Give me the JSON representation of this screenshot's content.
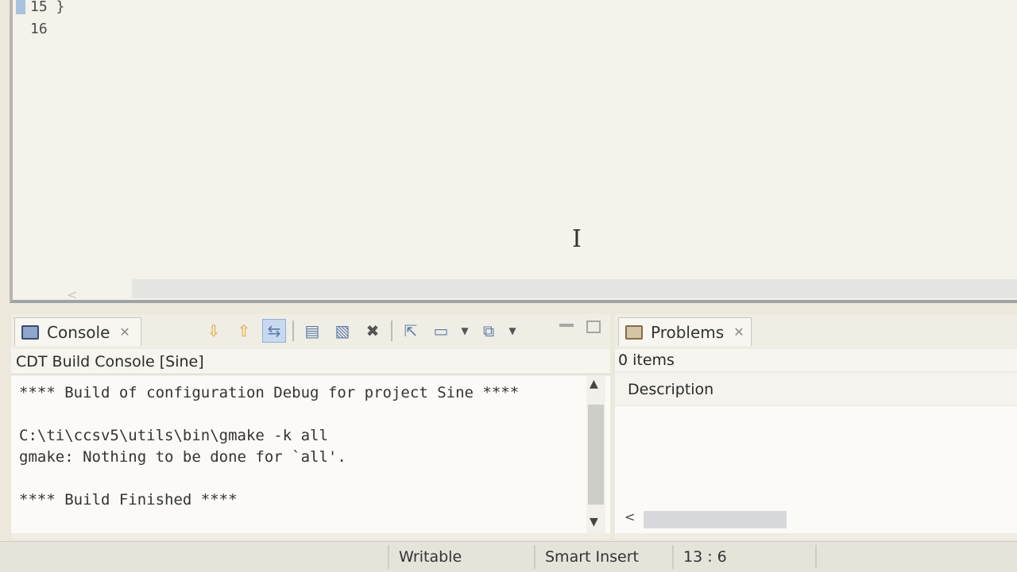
{
  "editor": {
    "lines": [
      {
        "number": "15",
        "text": "}"
      },
      {
        "number": "16",
        "text": ""
      }
    ]
  },
  "console": {
    "tab_label": "Console",
    "subtitle": "CDT Build Console [Sine]",
    "output_lines": [
      "**** Build of configuration Debug for project Sine ****",
      "",
      "C:\\ti\\ccsv5\\utils\\bin\\gmake -k all",
      "gmake: Nothing to be done for `all'.",
      "",
      "**** Build Finished ****"
    ]
  },
  "problems": {
    "tab_label": "Problems",
    "items_count": "0 items",
    "columns": [
      "Description"
    ]
  },
  "status_bar": {
    "writable": "Writable",
    "insert_mode": "Smart Insert",
    "position": "13 : 6"
  },
  "icons": {
    "console_tab": "console-icon",
    "problems_tab": "problems-icon",
    "close": "close-icon"
  }
}
